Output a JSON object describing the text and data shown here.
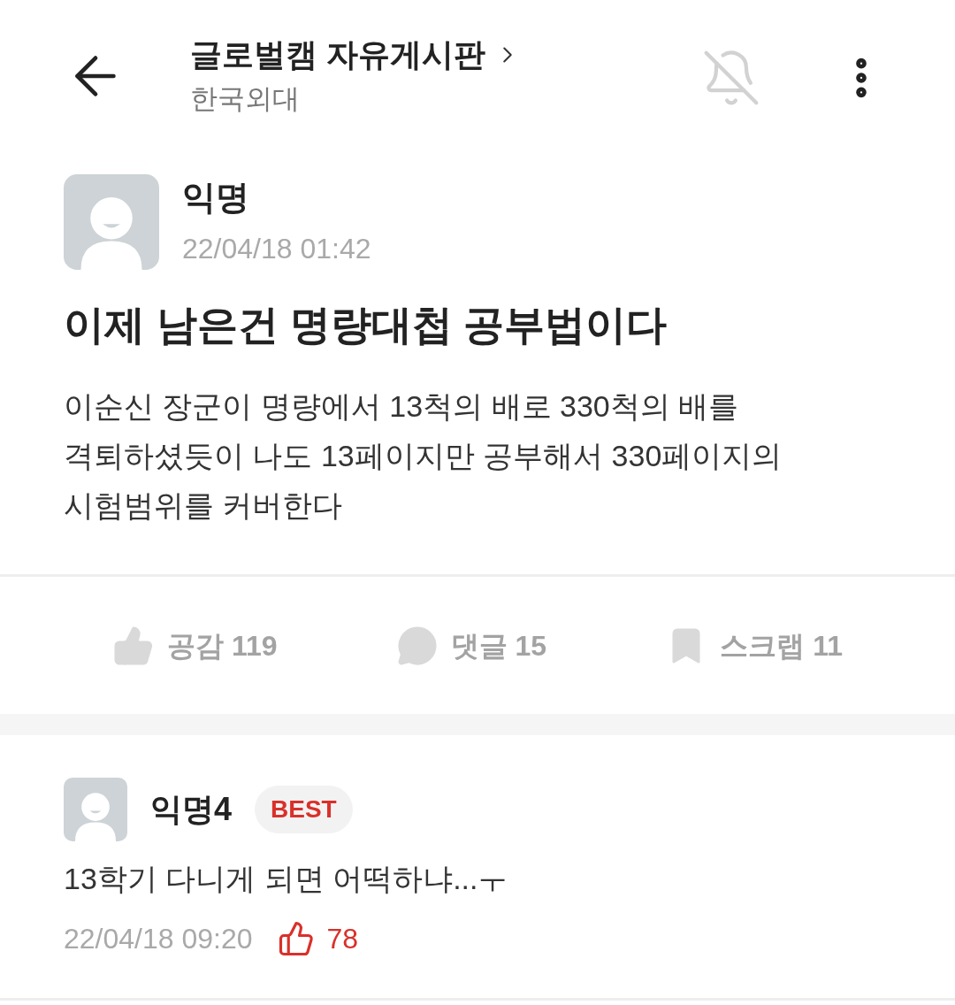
{
  "header": {
    "title": "글로벌캠 자유게시판",
    "subtitle": "한국외대",
    "notifications_on": false
  },
  "post": {
    "author": "익명",
    "date": "22/04/18 01:42",
    "title": "이제 남은건 명량대첩 공부법이다",
    "body": "이순신 장군이 명량에서 13척의 배로 330척의 배를 격퇴하셨듯이 나도 13페이지만 공부해서 330페이지의 시험범위를 커버한다"
  },
  "actions": [
    {
      "kind": "like",
      "label": "공감 119"
    },
    {
      "kind": "comment",
      "label": "댓글 15"
    },
    {
      "kind": "scrap",
      "label": "스크랩 11"
    }
  ],
  "comments": [
    {
      "author": "익명4",
      "badge": "BEST",
      "text": "13학기 다니게 되면 어떡하냐...ㅜ",
      "date": "22/04/18 09:20",
      "likes": "78"
    }
  ]
}
